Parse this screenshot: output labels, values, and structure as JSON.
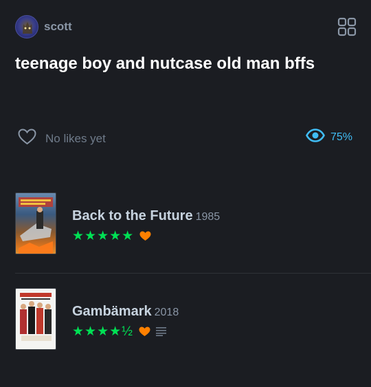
{
  "user": {
    "name": "scott"
  },
  "list": {
    "title": "teenage boy and nutcase old man bffs",
    "likes_text": "No likes yet",
    "watched_percent": "75%"
  },
  "films": [
    {
      "title": "Back to the Future",
      "year": "1985",
      "stars": "★★★★★",
      "rating": 5,
      "liked": true,
      "has_review": false
    },
    {
      "title": "Gambämark",
      "year": "2018",
      "stars": "★★★★½",
      "rating": 4.5,
      "liked": true,
      "has_review": true
    }
  ],
  "colors": {
    "background": "#1b1d22",
    "star": "#00e054",
    "heart": "#ff8000",
    "watched": "#40bcf4"
  },
  "icons": [
    "grid-view-icon",
    "heart-outline-icon",
    "eye-icon",
    "heart-icon",
    "review-lines-icon"
  ]
}
